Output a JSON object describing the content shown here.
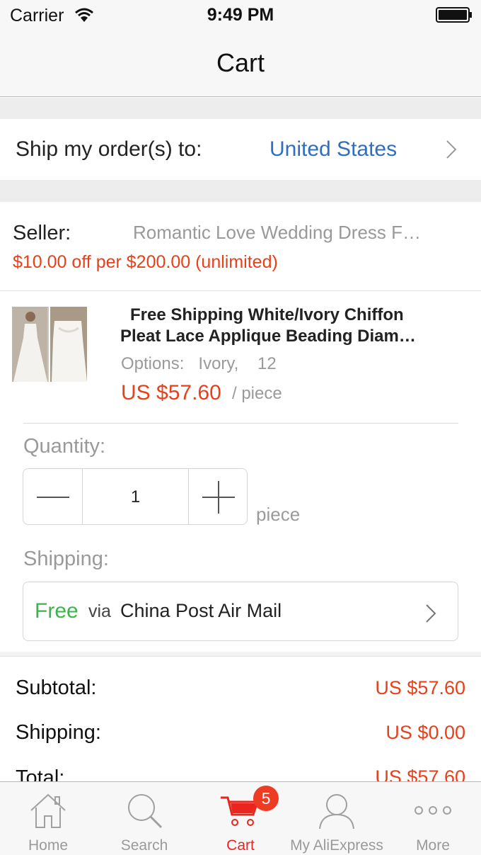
{
  "status_bar": {
    "carrier": "Carrier",
    "time": "9:49 PM"
  },
  "nav": {
    "title": "Cart"
  },
  "ship_to": {
    "label": "Ship my order(s) to:",
    "country": "United States"
  },
  "seller": {
    "label": "Seller:",
    "name": "Romantic Love Wedding Dress F…",
    "promotion": "$10.00 off per $200.00 (unlimited)"
  },
  "product": {
    "title_line1": "Free Shipping White/Ivory Chiffon",
    "title_line2": "Pleat Lace Applique Beading Diam…",
    "options_label": "Options:",
    "options_value": "Ivory,    12",
    "price": "US $57.60",
    "unit": "/ piece"
  },
  "quantity": {
    "label": "Quantity:",
    "value": "1",
    "unit": "piece"
  },
  "shipping": {
    "label": "Shipping:",
    "cost": "Free",
    "via": "via",
    "carrier": "China Post Air Mail"
  },
  "totals": {
    "subtotal_label": "Subtotal:",
    "subtotal_value": "US $57.60",
    "shipping_label": "Shipping:",
    "shipping_value": "US $0.00",
    "total_label": "Total:",
    "total_value": "US $57.60"
  },
  "tab_bar": {
    "tabs": [
      {
        "label": "Home",
        "icon": "home-icon"
      },
      {
        "label": "Search",
        "icon": "search-icon"
      },
      {
        "label": "Cart",
        "icon": "cart-icon",
        "badge": "5",
        "active": true
      },
      {
        "label": "My AliExpress",
        "icon": "user-icon"
      },
      {
        "label": "More",
        "icon": "more-icon"
      }
    ]
  },
  "colors": {
    "accent_red": "#e8401a",
    "link_blue": "#2f6fc0",
    "free_green": "#3bb54a",
    "muted_gray": "#9a9a9a"
  }
}
